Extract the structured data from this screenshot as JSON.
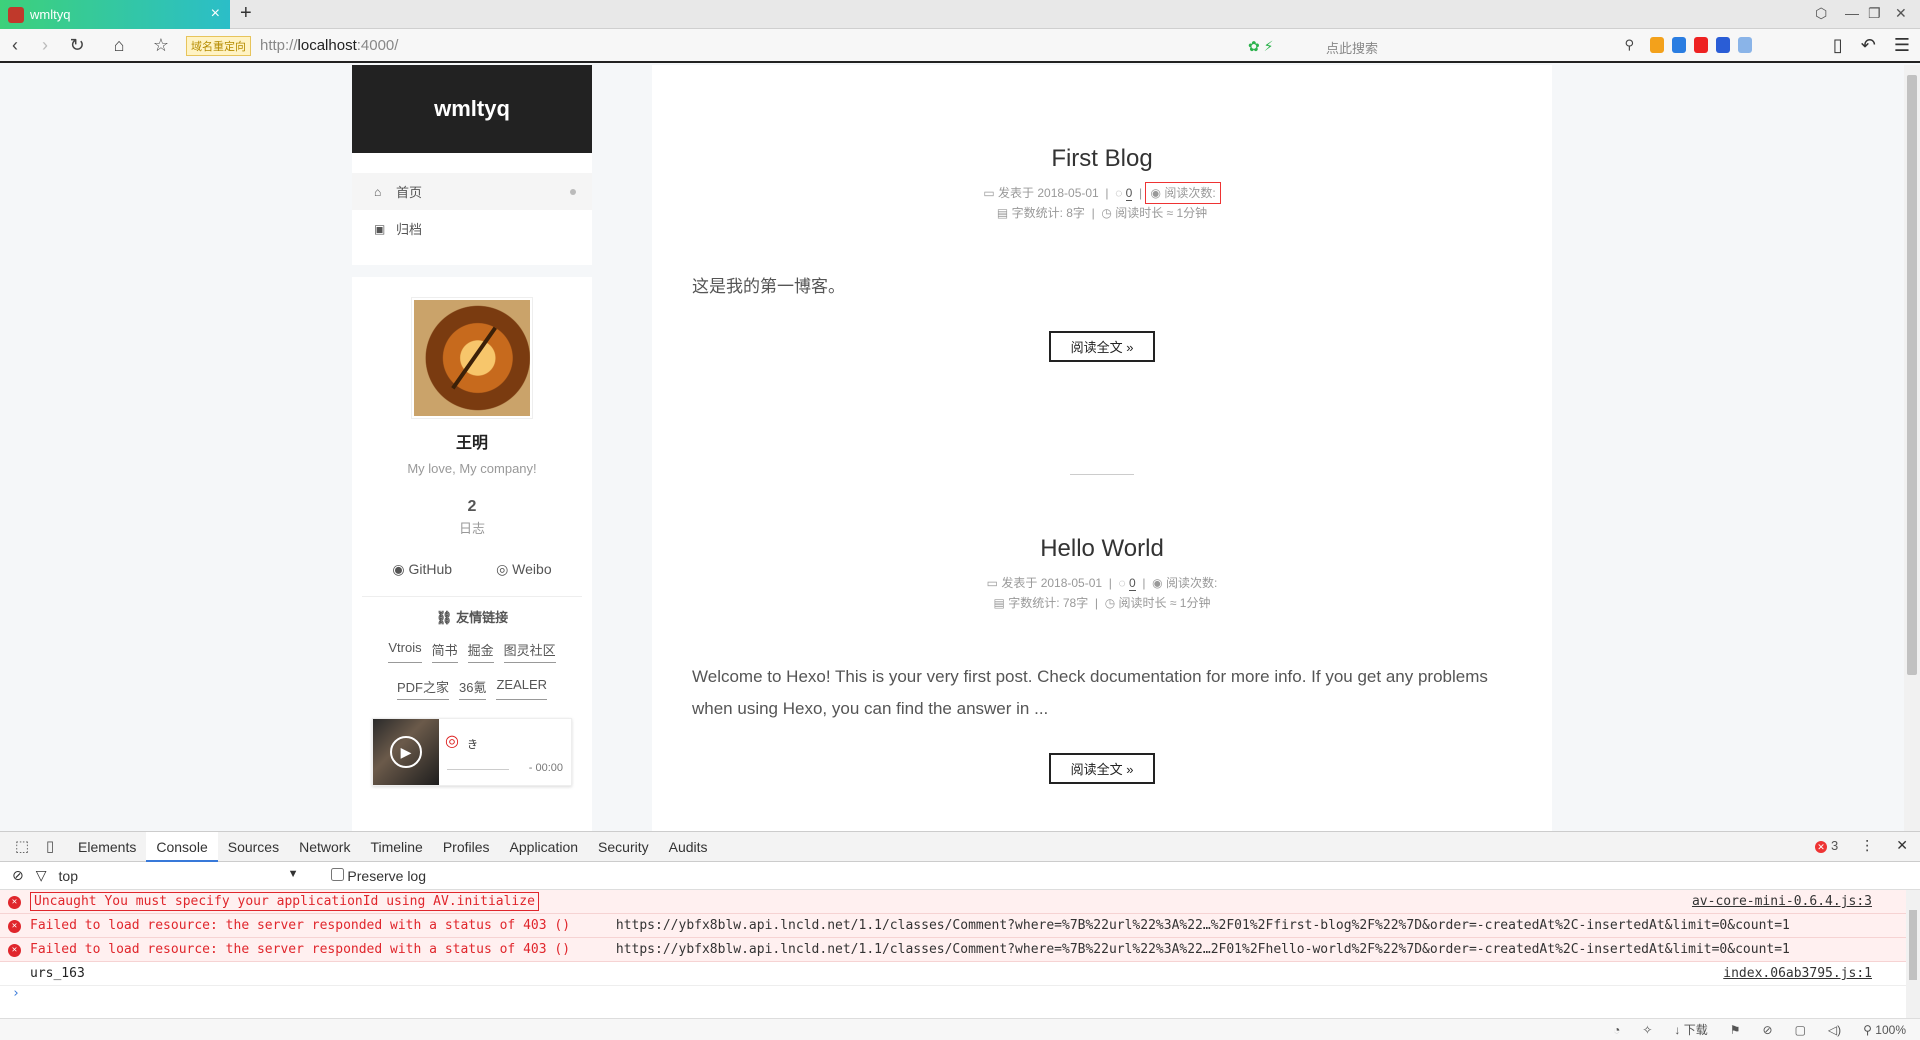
{
  "browser": {
    "tab_title": "wmltyq",
    "tab_close": "×",
    "new_tab": "+",
    "redirect_badge": "域名重定向",
    "url_scheme": "http://",
    "url_host": "localhost",
    "url_rest": ":4000/",
    "search_placeholder": "点此搜索"
  },
  "sidebar": {
    "brand": "wmltyq",
    "menu": [
      {
        "label": "首页",
        "icon": "home-icon"
      },
      {
        "label": "归档",
        "icon": "archive-icon"
      }
    ],
    "author_name": "王明",
    "motto": "My love, My company!",
    "posts_count": "2",
    "posts_label": "日志",
    "social": [
      {
        "label": "GitHub",
        "icon": "github-icon"
      },
      {
        "label": "Weibo",
        "icon": "weibo-icon"
      }
    ],
    "links_title": "友情链接",
    "links_row1": [
      "Vtrois",
      "简书",
      "掘金",
      "图灵社区"
    ],
    "links_row2": [
      "PDF之家",
      "36氪",
      "ZEALER"
    ],
    "player": {
      "song": "き",
      "time": "- 00:00"
    }
  },
  "posts": [
    {
      "title": "First Blog",
      "published": "发表于 2018-05-01",
      "comments": "0",
      "views": "阅读次数:",
      "wordcount": "字数统计: 8字",
      "readtime": "阅读时长 ≈ 1分钟",
      "excerpt": "这是我的第一博客。",
      "readmore": "阅读全文 »"
    },
    {
      "title": "Hello World",
      "published": "发表于 2018-05-01",
      "comments": "0",
      "views": "阅读次数:",
      "wordcount": "字数统计: 78字",
      "readtime": "阅读时长 ≈ 1分钟",
      "excerpt": "Welcome to Hexo! This is your very first post. Check documentation for more info. If you get any problems when using Hexo, you can find the answer in ...",
      "readmore": "阅读全文 »"
    }
  ],
  "devtools": {
    "tabs": [
      "Elements",
      "Console",
      "Sources",
      "Network",
      "Timeline",
      "Profiles",
      "Application",
      "Security",
      "Audits"
    ],
    "active_tab": "Console",
    "error_count": "3",
    "context": "top",
    "preserve_log": "Preserve log",
    "messages": [
      {
        "type": "error",
        "text": "Uncaught You must specify your applicationId using AV.initialize",
        "source": "av-core-mini-0.6.4.js:3"
      },
      {
        "type": "error",
        "text": "Failed to load resource: the server responded with a status of 403 ()",
        "url": "https://ybfx8blw.api.lncld.net/1.1/classes/Comment?where=%7B%22url%22%3A%22…%2F01%2Ffirst-blog%2F%22%7D&order=-createdAt%2C-insertedAt&limit=0&count=1"
      },
      {
        "type": "error",
        "text": "Failed to load resource: the server responded with a status of 403 ()",
        "url": "https://ybfx8blw.api.lncld.net/1.1/classes/Comment?where=%7B%22url%22%3A%22…2F01%2Fhello-world%2F%22%7D&order=-createdAt%2C-insertedAt&limit=0&count=1"
      },
      {
        "type": "log",
        "text": "urs_163",
        "source": "index.06ab3795.js:1"
      }
    ],
    "prompt": "›"
  },
  "statusbar": {
    "download": "下载",
    "zoom": "100%"
  },
  "colors": {
    "accent": "#3879d9",
    "error": "#e0262c",
    "tab_gradient_start": "#3dd17a",
    "tab_gradient_end": "#2bbec8",
    "brand_bg": "#222222"
  }
}
